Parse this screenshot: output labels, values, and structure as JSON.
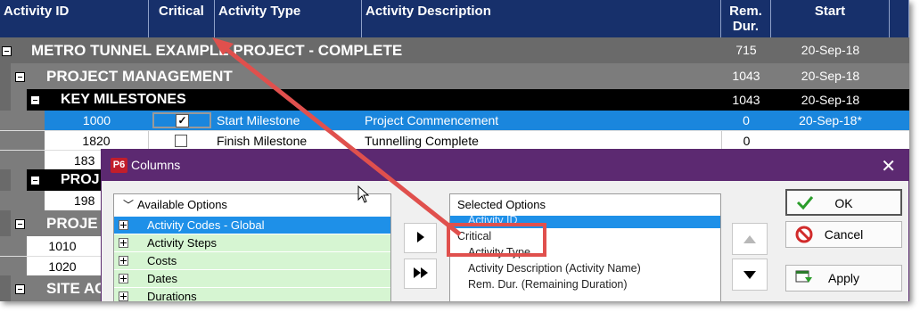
{
  "columns": {
    "activity_id": "Activity ID",
    "critical": "Critical",
    "activity_type": "Activity Type",
    "activity_description": "Activity Description",
    "rem_dur": "Rem.\nDur.",
    "start": "Start"
  },
  "rows": {
    "project": {
      "label": "METRO TUNNEL EXAMPLE PROJECT - COMPLETE",
      "rem": "715",
      "start": "20-Sep-18"
    },
    "pm": {
      "label": "PROJECT MANAGEMENT",
      "rem": "1043",
      "start": "20-Sep-18"
    },
    "km": {
      "label": "KEY MILESTONES",
      "rem": "1043",
      "start": "20-Sep-18"
    },
    "a1000": {
      "id": "1000",
      "type": "Start Milestone",
      "desc": "Project Commencement",
      "rem": "0",
      "start": "20-Sep-18*"
    },
    "a1820": {
      "id": "1820",
      "type": "Finish Milestone",
      "desc": "Tunnelling Complete",
      "rem": "0",
      "start": ""
    },
    "a183": {
      "id": "183"
    },
    "proj_partial": {
      "label": "PROJ"
    },
    "a198": {
      "id": "198"
    },
    "proje_partial": {
      "label": "PROJE"
    },
    "a1010": {
      "id": "1010"
    },
    "a1020": {
      "id": "1020"
    },
    "site_partial": {
      "label": "SITE AC"
    }
  },
  "dialog": {
    "title": "Columns",
    "icon_text": "P6",
    "available_header": "Available Options",
    "available": [
      "Activity Codes - Global",
      "Activity Steps",
      "Costs",
      "Dates",
      "Durations"
    ],
    "selected_header": "Selected Options",
    "selected": [
      "Activity ID",
      "Critical",
      "Activity Type",
      "Activity Description  (Activity Name)",
      "Rem. Dur.  (Remaining Duration)"
    ],
    "ok": "OK",
    "cancel": "Cancel",
    "apply": "Apply"
  }
}
